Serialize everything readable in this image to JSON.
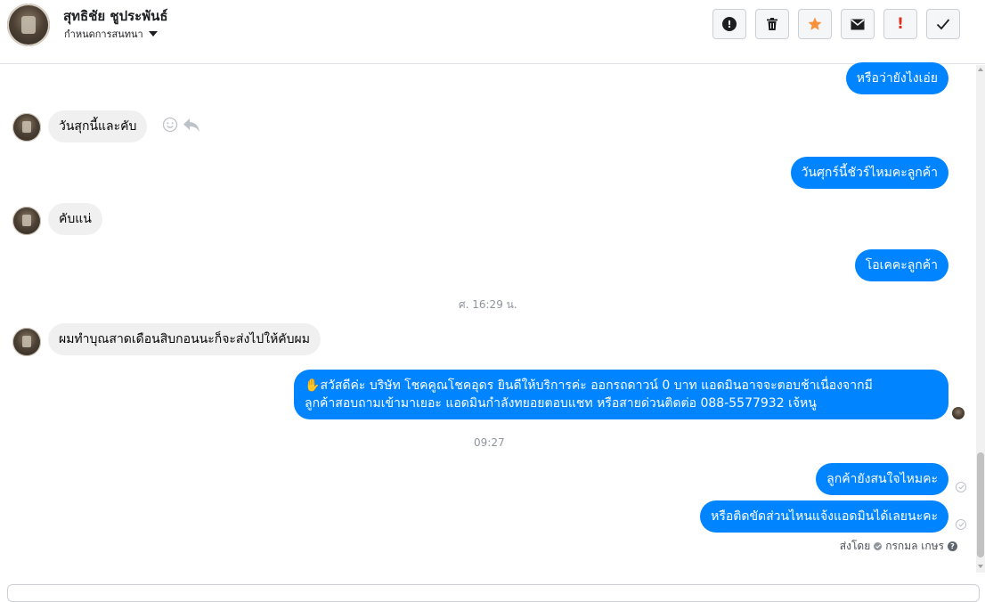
{
  "header": {
    "name": "สุทธิชัย ชูประพันธ์",
    "subtitle": "กำหนดการสนทนา",
    "toolbar": {
      "icons": [
        "exclamation-circle-icon",
        "trash-icon",
        "star-icon",
        "envelope-icon",
        "red-exclamation-icon",
        "checkmark-icon"
      ],
      "star_color": "#f7923b",
      "alert_color": "#e0301e"
    }
  },
  "messages": [
    {
      "dir": "out",
      "text": "หรือว่ายังไงเอ่ย"
    },
    {
      "dir": "in",
      "text": "วันสุกนี้และคับ"
    },
    {
      "dir": "out",
      "text": "วันศุกร์นี้ชัวร์ไหมคะลูกค้า"
    },
    {
      "dir": "in",
      "text": "คับแน่"
    },
    {
      "dir": "out",
      "text": "โอเคคะลูกค้า"
    },
    {
      "dir": "in",
      "text": "ผมทำบุณสาดเดือนสิบกอนนะก็จะส่งไปให้คับผม"
    },
    {
      "dir": "out",
      "emoji": "✋",
      "line1": "สวัสดีค่ะ บริษัท โชคคูณโชคอุดร ยินดีให้บริการค่ะ ออกรถดาวน์ 0 บาท แอดมินอาจจะตอบช้าเนื่องจากมี",
      "line2": "ลูกค้าสอบถามเข้ามาเยอะ แอดมินกำลังทยอยตอบแชท หรือสายด่วนติดต่อ 088-5577932 เจ้หนู"
    },
    {
      "dir": "out",
      "text": "ลูกค้ายังสนใจไหมคะ"
    },
    {
      "dir": "out",
      "text": "หรือติดขัดส่วนไหนแจ้งแอดมินได้เลยนะคะ"
    }
  ],
  "timestamps": {
    "first": "ศ. 16:29 น.",
    "second": "09:27"
  },
  "sent_by": {
    "label": "ส่งโดย",
    "name": "กรกมล เกษร"
  },
  "colors": {
    "outgoing_bubble": "#0084ff",
    "incoming_bubble": "#f1f0f0"
  }
}
